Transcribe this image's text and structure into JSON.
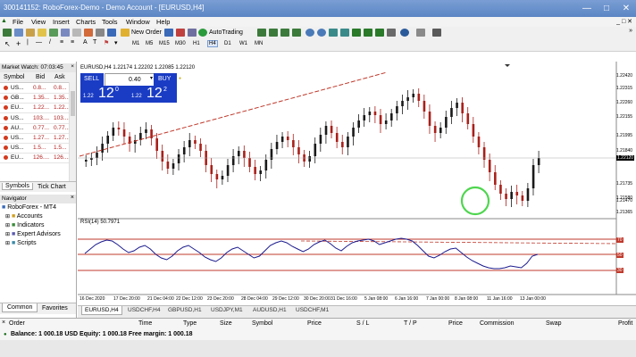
{
  "window": {
    "title": "300141152: RoboForex-Demo - Demo Account - [EURUSD,H4]"
  },
  "menu": [
    "File",
    "View",
    "Insert",
    "Charts",
    "Tools",
    "Window",
    "Help"
  ],
  "toolbar": {
    "new_order": "New Order",
    "autotrading": "AutoTrading",
    "timeframes": [
      "M1",
      "M5",
      "M15",
      "M30",
      "H1",
      "H4",
      "D1",
      "W1",
      "MN"
    ],
    "active_timeframe": "H4"
  },
  "market_watch": {
    "title": "Market Watch: 07:03:45",
    "headers": {
      "symbol": "Symbol",
      "bid": "Bid",
      "ask": "Ask"
    },
    "rows": [
      {
        "symbol": "US...",
        "bid": "0.8...",
        "ask": "0.8..."
      },
      {
        "symbol": "GB...",
        "bid": "1.35...",
        "ask": "1.35..."
      },
      {
        "symbol": "EU...",
        "bid": "1.22...",
        "ask": "1.22..."
      },
      {
        "symbol": "US...",
        "bid": "103....",
        "ask": "103...."
      },
      {
        "symbol": "AU...",
        "bid": "0.77...",
        "ask": "0.77..."
      },
      {
        "symbol": "US...",
        "bid": "1.27...",
        "ask": "1.27..."
      },
      {
        "symbol": "US...",
        "bid": "1.5...",
        "ask": "1.5..."
      },
      {
        "symbol": "EU...",
        "bid": "126....",
        "ask": "126...."
      }
    ],
    "tabs": [
      "Symbols",
      "Tick Chart"
    ]
  },
  "navigator": {
    "title": "Navigator",
    "items": [
      "RoboForex - MT4",
      "Accounts",
      "Indicators",
      "Expert Advisors",
      "Scripts"
    ],
    "tabs": [
      "Common",
      "Favorites"
    ]
  },
  "chart": {
    "header": "EURUSD,H4 1.22174 1.22202 1.22085 1.22120",
    "sell": "SELL",
    "buy": "BUY",
    "lot": "0.40",
    "bid_prefix": "1.22",
    "bid_big": "12",
    "bid_sup": "0",
    "ask_prefix": "1.22",
    "ask_big": "12",
    "ask_sup": "2",
    "price_scale": [
      "1.22420",
      "1.22315",
      "1.22260",
      "1.22155",
      "1.21995",
      "1.21840",
      "1.21735",
      "1.21580",
      "1.21470",
      "1.21365"
    ],
    "current_price": "1.22120",
    "rsi_label": "RSI(14) 50.7971",
    "rsi_scale": [
      "70",
      "50",
      "30"
    ],
    "time_labels": [
      "16 Dec 2020",
      "17 Dec 20:00",
      "21 Dec 04:00",
      "22 Dec 12:00",
      "23 Dec 20:00",
      "28 Dec 04:00",
      "29 Dec 12:00",
      "30 Dec 20:00",
      "31 Dec 16:00",
      "5 Jan 08:00",
      "6 Jan 16:00",
      "7 Jan 00:00",
      "8 Jan 08:00",
      "11 Jan 16:00",
      "13 Jan 00:00"
    ],
    "colors": {
      "bull": "#1a1a1a",
      "bear": "#a8201a",
      "trend": "#c0392b",
      "rsi": "#1b1b8f",
      "levels": "#c0392b",
      "circle": "#4fd64f"
    }
  },
  "chart_tabs": [
    "EURUSD,H4",
    "USDCHF,H4",
    "GBPUSD,H1",
    "USDJPY,M1",
    "AUDUSD,H1",
    "USDCHF,M1"
  ],
  "terminal": {
    "columns": [
      "Order",
      "Time",
      "Type",
      "Size",
      "Symbol",
      "Price",
      "S / L",
      "T / P",
      "Price",
      "Commission",
      "Swap",
      "Profit"
    ],
    "balance_line": "Balance: 1 000.18 USD  Equity: 1 000.18  Free margin: 1 000.18"
  }
}
